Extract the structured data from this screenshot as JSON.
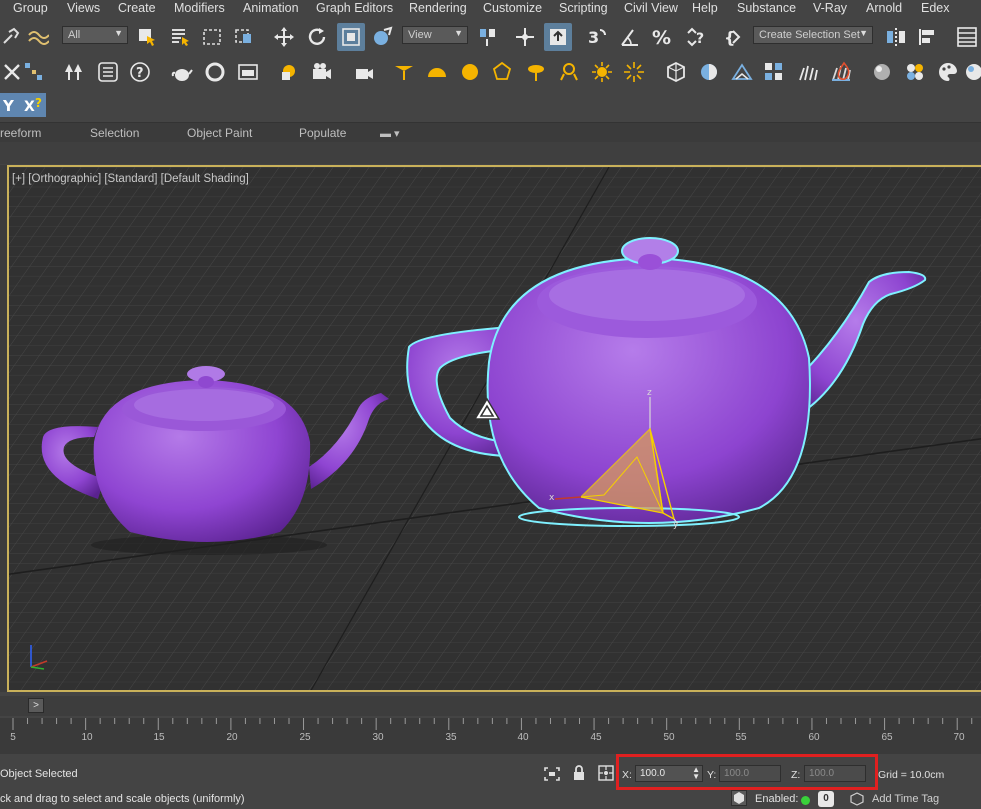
{
  "menu": [
    "Group",
    "Views",
    "Create",
    "Modifiers",
    "Animation",
    "Graph Editors",
    "Rendering",
    "Customize",
    "Scripting",
    "Civil View",
    "Help",
    "Substance",
    "V-Ray",
    "Arnold",
    "Edex"
  ],
  "toolbar": {
    "filter_value": "All",
    "ref_coord_value": "View",
    "selection_set_value": "Create Selection Set"
  },
  "ribbon": {
    "tabs": [
      "reeform",
      "Selection",
      "Object Paint",
      "Populate"
    ]
  },
  "viewport": {
    "label": "[+] [Orthographic] [Standard] [Default Shading]",
    "object_color": "#9b4fd6",
    "selection_outline_color": "#7ff0ff"
  },
  "timeline": {
    "thumb": ">",
    "ticks": [
      "5",
      "10",
      "15",
      "20",
      "25",
      "30",
      "35",
      "40",
      "45",
      "50",
      "55",
      "60",
      "65",
      "70"
    ]
  },
  "status": {
    "selection_text": "Object Selected",
    "prompt_text": "ck and drag to select and scale objects (uniformly)",
    "x_label": "X:",
    "x_value": "100.0",
    "y_label": "Y:",
    "y_value": "100.0",
    "z_label": "Z:",
    "z_value": "100.0",
    "grid_text": "Grid = 10.0cm",
    "enabled_label": "Enabled:",
    "enabled_count": "0",
    "add_time_tag": "Add Time Tag",
    "highlight_color": "#e02020"
  }
}
